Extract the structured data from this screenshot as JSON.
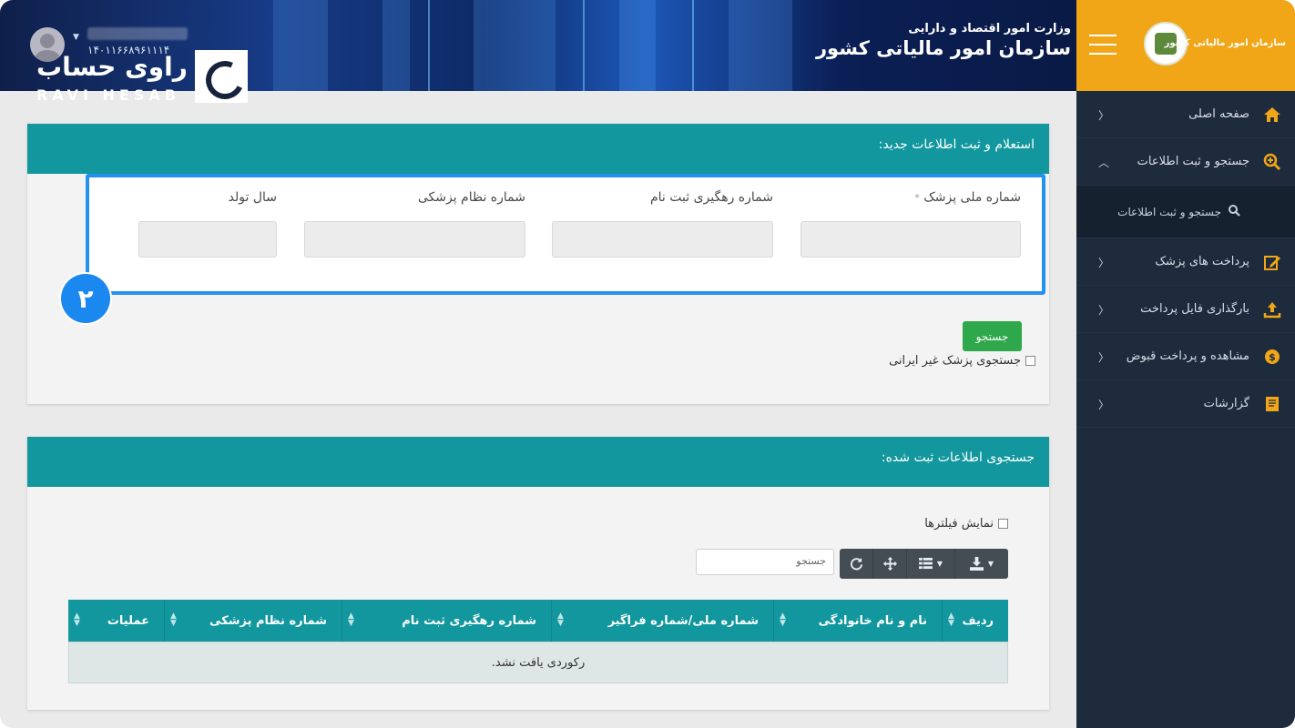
{
  "header": {
    "ministry": "وزارت امور اقتصاد و دارایی",
    "org_title": "سازمان امور مالیاتی کشور",
    "user_id": "۱۴۰۱۱۶۶۸۹۶۱۱۱۴"
  },
  "logo": {
    "fa": "راوی حساب",
    "en": "RAVI HESAB"
  },
  "sidebar": {
    "org_label": "سازمان امور مالیاتی کشور",
    "items": [
      {
        "label": "صفحه اصلی",
        "icon": "home-icon"
      },
      {
        "label": "جستجو و ثبت اطلاعات",
        "icon": "search-plus-icon",
        "open": true
      },
      {
        "label": "پرداخت های پزشک",
        "icon": "edit-icon"
      },
      {
        "label": "بارگذاری فایل پرداخت",
        "icon": "upload-icon"
      },
      {
        "label": "مشاهده و پرداخت قبوض",
        "icon": "coin-icon"
      },
      {
        "label": "گزارشات",
        "icon": "book-icon"
      }
    ],
    "subitem": {
      "label": "جستجو و ثبت اطلاعات",
      "icon": "search-icon"
    }
  },
  "inquiry_panel": {
    "title": "استعلام و ثبت اطلاعات جدید:",
    "fields": [
      {
        "label": "شماره ملی پزشک",
        "required_mark": "*"
      },
      {
        "label": "شماره رهگیری ثبت نام"
      },
      {
        "label": "شماره نظام پزشکی"
      },
      {
        "label": "سال تولد"
      }
    ],
    "step_badge": "۲",
    "search_button": "جستجو",
    "foreign_checkbox": "جستجوی پزشک غیر ایرانی"
  },
  "records_panel": {
    "title": "جستجوی اطلاعات ثبت شده:",
    "filters_checkbox": "نمایش فیلترها",
    "search_placeholder": "جستجو",
    "columns": [
      "ردیف",
      "نام و نام خانوادگی",
      "شماره ملی/شماره فراگیر",
      "شماره رهگیری ثبت نام",
      "شماره نظام پزشکی",
      "عملیات"
    ],
    "empty_message": "رکوردی یافت نشد."
  },
  "colors": {
    "teal": "#11979d",
    "accent_orange": "#f1a618",
    "sidebar_bg": "#1d2b3c",
    "highlight_blue": "#2591ee",
    "success_green": "#2ea84a"
  }
}
